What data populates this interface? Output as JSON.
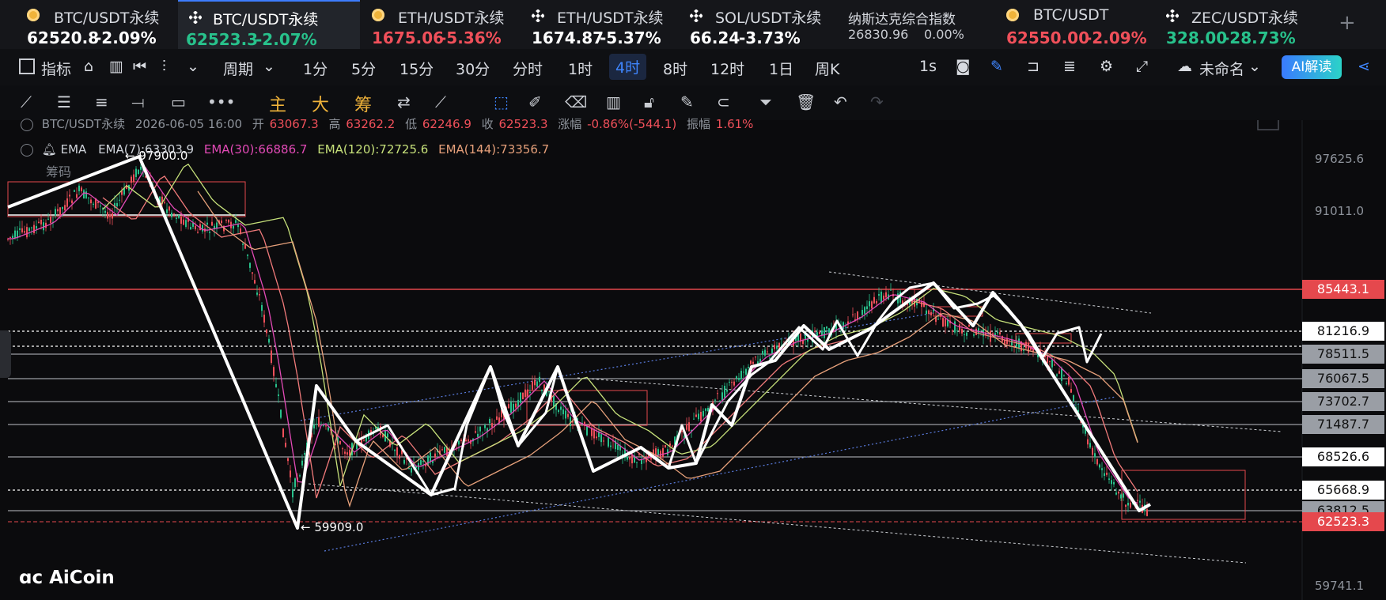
{
  "tickers": [
    {
      "name": "BTC/USDT永续",
      "price": "62520.8",
      "change": "-2.09%",
      "color": "#ffffff",
      "change_color": "#ffffff",
      "icon": "btc-coin-icon"
    },
    {
      "name": "BTC/USDT永续",
      "price": "62523.3",
      "change": "-2.07%",
      "color": "#28c28c",
      "change_color": "#28c28c",
      "icon": "binance-icon",
      "active": true
    },
    {
      "name": "ETH/USDT永续",
      "price": "1675.06",
      "change": "-5.36%",
      "color": "#f0505a",
      "change_color": "#f0505a",
      "icon": "btc-coin-icon"
    },
    {
      "name": "ETH/USDT永续",
      "price": "1674.87",
      "change": "-5.37%",
      "color": "#ffffff",
      "change_color": "#ffffff",
      "icon": "binance-icon"
    },
    {
      "name": "SOL/USDT永续",
      "price": "66.24",
      "change": "-3.73%",
      "color": "#ffffff",
      "change_color": "#ffffff",
      "icon": "binance-icon"
    },
    {
      "name": "纳斯达克综合指数",
      "price": "26830.96",
      "change": "0.00%",
      "color": "#c9ccd2",
      "change_color": "#c9ccd2",
      "icon": ""
    },
    {
      "name": "BTC/USDT",
      "price": "62550.00",
      "change": "-2.09%",
      "color": "#f0505a",
      "change_color": "#f0505a",
      "icon": "btc-coin-icon"
    },
    {
      "name": "ZEC/USDT永续",
      "price": "328.00",
      "change": "-28.73%",
      "color": "#28c28c",
      "change_color": "#28c28c",
      "icon": "binance-icon"
    }
  ],
  "toolbar": {
    "indicator": "指标",
    "period": "周期",
    "intervals": [
      "1分",
      "5分",
      "15分",
      "30分",
      "分时",
      "1时",
      "4时",
      "8时",
      "12时",
      "1日",
      "周K"
    ],
    "active_interval": "4时",
    "second": "1s",
    "layout_name": "未命名",
    "ai_label": "AI解读"
  },
  "drawtools": {
    "main": "主",
    "big": "大",
    "chips": "筹"
  },
  "info": {
    "symbol": "BTC/USDT永续",
    "datetime": "2026-06-05 16:00",
    "open_label": "开",
    "open": "63067.3",
    "high_label": "高",
    "high": "63262.2",
    "low_label": "低",
    "low": "62246.9",
    "close_label": "收",
    "close": "62523.3",
    "chg_label": "涨幅",
    "chg": "-0.86%(-544.1)",
    "amp_label": "振幅",
    "amp": "1.61%",
    "ema_title": "EMA",
    "ema7": "EMA(7):63303.9",
    "ema30": "EMA(30):66886.7",
    "ema120": "EMA(120):72725.6",
    "ema144": "EMA(144):73356.7",
    "chips_label": "筹码",
    "peak_label": "← 97900.0",
    "trough_label": "← 59909.0"
  },
  "price_scale": {
    "axis": [
      "97625.6",
      "91011.0",
      "65668.9",
      "59741.1"
    ],
    "levels": [
      {
        "text": "85443.1",
        "style": "red"
      },
      {
        "text": "81216.9",
        "style": "white"
      },
      {
        "text": "78511.5",
        "style": "gray"
      },
      {
        "text": "76067.5",
        "style": "gray"
      },
      {
        "text": "73702.7",
        "style": "gray"
      },
      {
        "text": "71487.7",
        "style": "gray"
      },
      {
        "text": "68526.6",
        "style": "white"
      },
      {
        "text": "65668.9",
        "style": "white"
      },
      {
        "text": "63812.5",
        "style": "gray"
      },
      {
        "text": "62523.3",
        "style": "red"
      }
    ]
  },
  "logo": "AiCoin",
  "colors": {
    "up": "#28c28c",
    "down": "#f0505a",
    "accent": "#3f86ff",
    "ema7": "#e24ab6",
    "ema30": "#f07a7a",
    "ema120": "#c6e07a",
    "ema144": "#e6a07a"
  }
}
